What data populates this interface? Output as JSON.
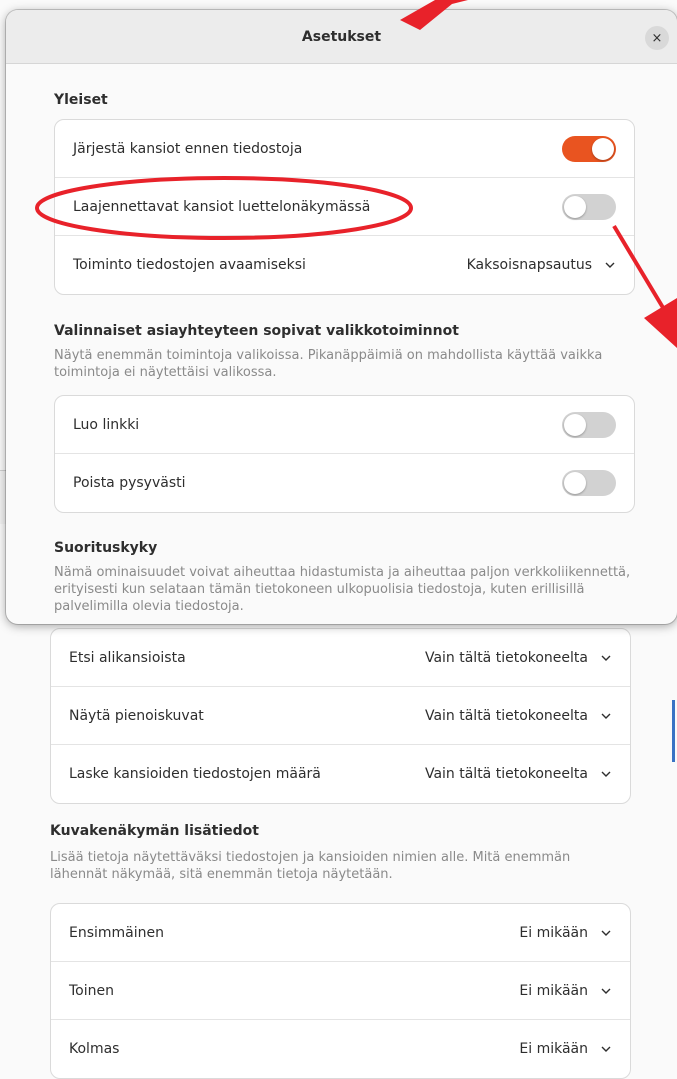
{
  "background": {
    "performance_rows": [
      {
        "label": "Etsi alikansioista",
        "value": "Vain tältä tietokoneelta"
      },
      {
        "label": "Näytä pienoiskuvat",
        "value": "Vain tältä tietokoneelta"
      },
      {
        "label": "Laske kansioiden tiedostojen määrä",
        "value": "Vain tältä tietokoneelta"
      }
    ],
    "icon_view": {
      "heading": "Kuvakenäkymän lisätiedot",
      "description": "Lisää tietoja näytettäväksi tiedostojen ja kansioiden nimien alle. Mitä enemmän lähennät näkymää, sitä enemmän tietoja näytetään.",
      "rows": [
        {
          "label": "Ensimmäinen",
          "value": "Ei mikään"
        },
        {
          "label": "Toinen",
          "value": "Ei mikään"
        },
        {
          "label": "Kolmas",
          "value": "Ei mikään"
        }
      ]
    }
  },
  "dialog": {
    "title": "Asetukset",
    "close_icon": "×",
    "general": {
      "heading": "Yleiset",
      "sort_folders_label": "Järjestä kansiot ennen tiedostoja",
      "sort_folders_on": true,
      "expandable_folders_label": "Laajennettavat kansiot luettelonäkymässä",
      "expandable_folders_on": false,
      "open_action_label": "Toiminto tiedostojen avaamiseksi",
      "open_action_value": "Kaksoisnapsautus"
    },
    "context_menu": {
      "heading": "Valinnaiset asiayhteyteen sopivat valikkotoiminnot",
      "description": "Näytä enemmän toimintoja valikoissa. Pikanäppäimiä on mahdollista käyttää vaikka toimintoja ei näytettäisi valikossa.",
      "create_link_label": "Luo linkki",
      "create_link_on": false,
      "delete_permanently_label": "Poista pysyvästi",
      "delete_permanently_on": false
    },
    "performance": {
      "heading": "Suorituskyky",
      "description": "Nämä ominaisuudet voivat aiheuttaa hidastumista ja aiheuttaa paljon verkkoliikennettä, erityisesti kun selataan tämän tietokoneen ulkopuolisia tiedostoja, kuten erillisillä palvelimilla olevia tiedostoja."
    }
  },
  "colors": {
    "accent": "#e95420",
    "annotation": "#e8222a"
  }
}
